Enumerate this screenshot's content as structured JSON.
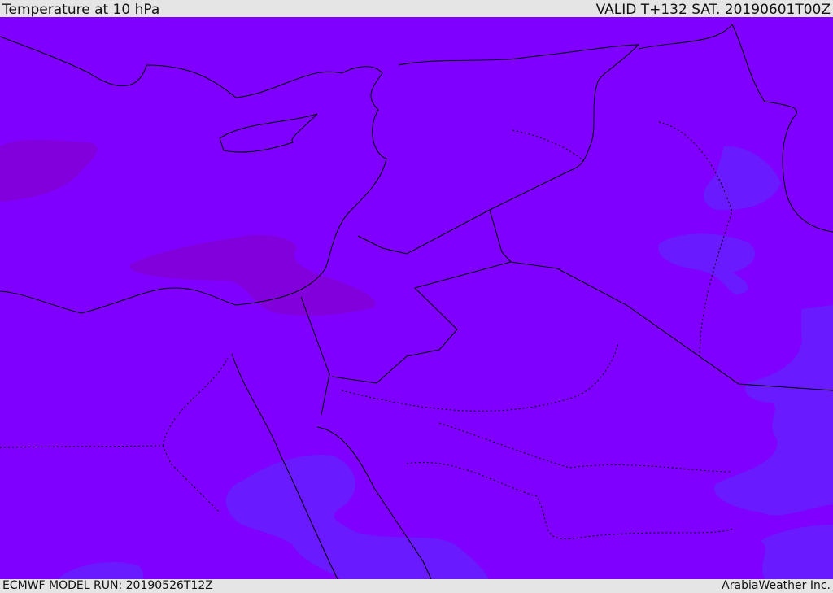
{
  "header": {
    "title": "Temperature at 10 hPa",
    "valid": "VALID T+132 SAT. 20190601T00Z"
  },
  "footer": {
    "model_run": "ECMWF MODEL RUN: 20190526T12Z",
    "credit": "ArabiaWeather Inc."
  },
  "colors": {
    "base": "#7f00ff",
    "warm": "#8200dc",
    "cool": "#6a1aff",
    "coast": "#000000"
  }
}
